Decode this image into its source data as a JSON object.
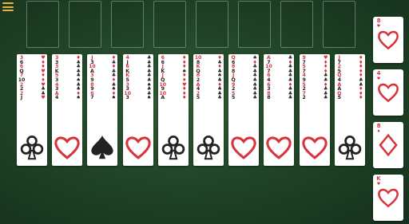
{
  "menu": {
    "icon": "hamburger-menu-icon"
  },
  "foundation_count": 8,
  "colors": {
    "red": "#d8343c",
    "black": "#222222",
    "menu_accent": "#e8b244",
    "felt": "#214528"
  },
  "tableau": [
    {
      "suit": "clubs",
      "left_ranks": [
        "3",
        "6",
        "6",
        "Q",
        "7",
        "10",
        "2",
        "2",
        "2",
        "J"
      ],
      "right_ranks": [
        "♥",
        "♦",
        "♦",
        "♥",
        "♦",
        "♦",
        "♥",
        "♣",
        "♣",
        "♥"
      ]
    },
    {
      "suit": "hearts",
      "left_ranks": [
        "3",
        "3",
        "3",
        "K",
        "5",
        "3",
        "4",
        "3",
        "A",
        "4"
      ],
      "right_ranks": [
        "♦",
        "♣",
        "♣",
        "♣",
        "♣",
        "♠",
        "♣",
        "♣",
        "♦",
        "♠"
      ]
    },
    {
      "suit": "spades",
      "left_ranks": [
        "J",
        "3",
        "10",
        "A",
        "3",
        "9",
        "8",
        "9",
        "6",
        "7"
      ],
      "right_ranks": [
        "♦",
        "♣",
        "♦",
        "♣",
        "♣",
        "♦",
        "♣",
        "♠",
        "♦",
        "♠"
      ]
    },
    {
      "suit": "hearts",
      "left_ranks": [
        "4",
        "J",
        "6",
        "K",
        "K",
        "5",
        "3",
        "3",
        "10",
        "3"
      ],
      "right_ranks": [
        "♣",
        "♣",
        "♣",
        "♣",
        "♣",
        "♣",
        "♠",
        "♣",
        "♣",
        "♠"
      ]
    },
    {
      "suit": "clubs",
      "left_ranks": [
        "6",
        "6",
        "J",
        "K",
        "J",
        "Q",
        "10",
        "9",
        "10",
        "A"
      ],
      "right_ranks": [
        "♦",
        "♦",
        "♦",
        "♠",
        "♦",
        "♦",
        "♥",
        "♦",
        "♦",
        "♦"
      ]
    },
    {
      "suit": "clubs",
      "left_ranks": [
        "10",
        "8",
        "K",
        "Q",
        "8",
        "2",
        "A",
        "4",
        "2",
        "5"
      ],
      "right_ranks": [
        "♦",
        "♣",
        "♦",
        "♣",
        "♠",
        "♣",
        "♦",
        "♣",
        "♣",
        "♣"
      ]
    },
    {
      "suit": "hearts",
      "left_ranks": [
        "Q",
        "6",
        "8",
        "8",
        "J",
        "Q",
        "9",
        "2",
        "5",
        "5"
      ],
      "right_ranks": [
        "♠",
        "♦",
        "♣",
        "♣",
        "♣",
        "♣",
        "♣",
        "♣",
        "♣",
        "♣"
      ]
    },
    {
      "suit": "hearts",
      "left_ranks": [
        "A",
        "7",
        "10",
        "7",
        "6",
        "4",
        "6",
        "3",
        "8",
        "8"
      ],
      "right_ranks": [
        "♣",
        "♦",
        "♣",
        "♣",
        "♣",
        "♣",
        "♦",
        "♣",
        "♣",
        "♣"
      ]
    },
    {
      "suit": "hearts",
      "left_ranks": [
        "9",
        "7",
        "5",
        "7",
        "4",
        "9",
        "5",
        "2",
        "7",
        "2"
      ],
      "right_ranks": [
        "♥",
        "♦",
        "♦",
        "♦",
        "♣",
        "♣",
        "♦",
        "♣",
        "♣",
        "♣"
      ]
    },
    {
      "suit": "clubs",
      "left_ranks": [
        "J",
        "7",
        "2",
        "5",
        "Q",
        "4",
        "A",
        "A",
        "Q",
        "5"
      ],
      "right_ranks": [
        "♦",
        "♦",
        "♦",
        "♦",
        "♦",
        "♣",
        "♣",
        "♦",
        "♦",
        "♦"
      ]
    }
  ],
  "stock": [
    {
      "rank": "8",
      "suit": "hearts",
      "suit_glyph": "♥"
    },
    {
      "rank": "4",
      "suit": "hearts",
      "suit_glyph": "♥"
    },
    {
      "rank": "8",
      "suit": "diamonds",
      "suit_glyph": "♦"
    },
    {
      "rank": "K",
      "suit": "hearts",
      "suit_glyph": "♥"
    }
  ]
}
